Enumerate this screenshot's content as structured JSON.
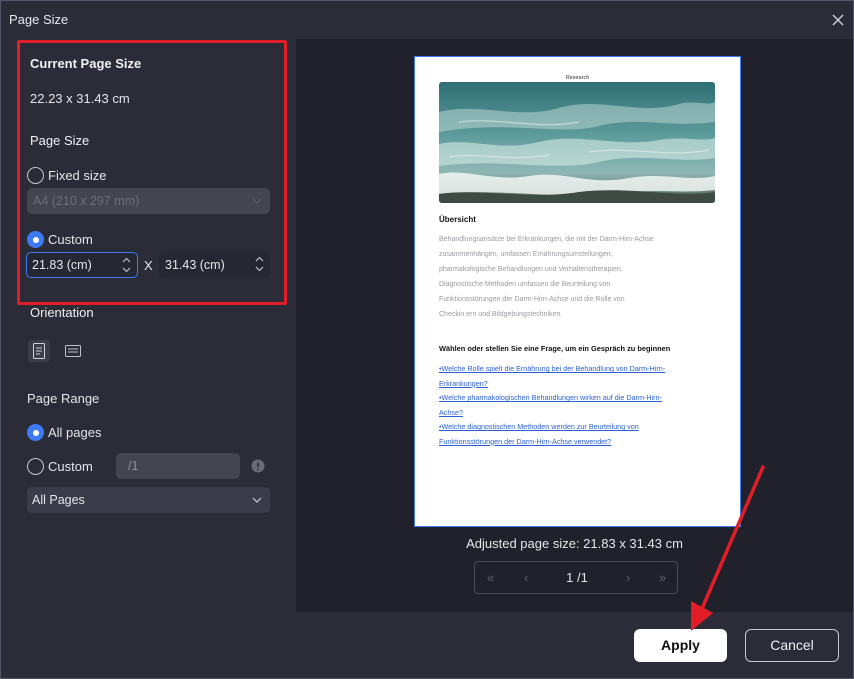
{
  "window": {
    "title": "Page Size"
  },
  "left_panel": {
    "current_size_heading": "Current Page Size",
    "current_size_value": "22.23 x 31.43 cm",
    "page_size_heading": "Page Size",
    "fixed_size_label": "Fixed size",
    "fixed_size_value": "A4 (210 x 297 mm)",
    "custom_label": "Custom",
    "width_value": "21.83 (cm)",
    "separator": "X",
    "height_value": "31.43 (cm)",
    "orientation_heading": "Orientation",
    "page_range_heading": "Page Range",
    "all_pages_label": "All pages",
    "range_custom_label": "Custom",
    "range_placeholder": "/1",
    "range_select_value": "All Pages"
  },
  "preview": {
    "page_header": "Research",
    "heading1": "Übersicht",
    "para_lines": [
      "Behandlungsansätze bei Erkrankungen, die mit der Darm-Hirn-Achse",
      "zusammenhängen, umfassen Ernährungsumstellungen,",
      "pharmakologische Behandlungen und Verhaltenstherapien.",
      "Diagnostische Methoden umfassen die Beurteilung von",
      "Funktionsstörungen der Darm-Hirn-Achse und die Rolle von",
      "Checkin ern und Bildgebungstechniken."
    ],
    "heading2": "Wählen oder stellen Sie eine Frage, um ein Gespräch zu beginnen",
    "links": [
      "•Welche Rolle spielt die Ernährung bei der Behandlung von Darm-Hirn-",
      "Erkrankungen?",
      "•Welche pharmakologischen Behandlungen wirken auf die Darm-Hirn-",
      "Achse?",
      "•Welche diagnostischen Methoden werden zur Beurteilung von",
      "Funktionsstörungen der Darm-Hirn-Achse verwendet?"
    ],
    "adjusted_size": "Adjusted page size: 21.83 x 31.43 cm",
    "pager": {
      "first": "«",
      "prev": "‹",
      "page": "1 /1",
      "next": "›",
      "last": "»"
    }
  },
  "footer": {
    "apply_label": "Apply",
    "cancel_label": "Cancel"
  },
  "colors": {
    "accent": "#3d7bf5",
    "highlight": "#e11e28",
    "background": "#2b2c38"
  }
}
